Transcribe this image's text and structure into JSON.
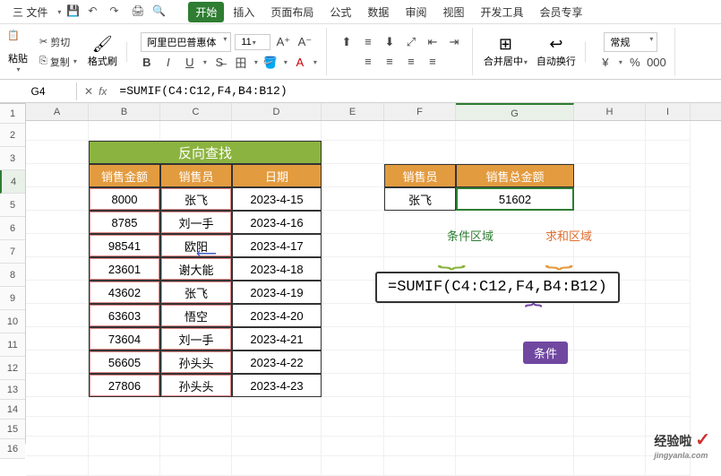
{
  "menu": {
    "file": "三 文件",
    "icons": [
      "save",
      "undo",
      "redo",
      "print",
      "preview"
    ],
    "tabs": [
      "开始",
      "插入",
      "页面布局",
      "公式",
      "数据",
      "审阅",
      "视图",
      "开发工具",
      "会员专享"
    ],
    "active": 0
  },
  "toolbar": {
    "cut": "剪切",
    "copy": "复制",
    "paste": "粘贴",
    "format_painter": "格式刷",
    "font_name": "阿里巴巴普惠体",
    "font_size": "11",
    "merge": "合并居中",
    "wrap": "自动换行",
    "number_fmt": "常规"
  },
  "refbar": {
    "cell": "G4",
    "formula": "=SUMIF(C4:C12,F4,B4:B12)"
  },
  "columns": [
    "A",
    "B",
    "C",
    "D",
    "E",
    "F",
    "G",
    "H",
    "I"
  ],
  "rows": [
    "1",
    "2",
    "3",
    "4",
    "5",
    "6",
    "7",
    "8",
    "9",
    "10",
    "11",
    "12",
    "13",
    "14",
    "15",
    "16"
  ],
  "table": {
    "title": "反向查找",
    "headers": [
      "销售金额",
      "销售员",
      "日期"
    ],
    "data": [
      [
        "8000",
        "张飞",
        "2023-4-15"
      ],
      [
        "8785",
        "刘一手",
        "2023-4-16"
      ],
      [
        "98541",
        "欧阳",
        "2023-4-17"
      ],
      [
        "23601",
        "谢大能",
        "2023-4-18"
      ],
      [
        "43602",
        "张飞",
        "2023-4-19"
      ],
      [
        "63603",
        "悟空",
        "2023-4-20"
      ],
      [
        "73604",
        "刘一手",
        "2023-4-21"
      ],
      [
        "56605",
        "孙头头",
        "2023-4-22"
      ],
      [
        "27806",
        "孙头头",
        "2023-4-23"
      ]
    ]
  },
  "result": {
    "headers": [
      "销售员",
      "销售总金额"
    ],
    "row": [
      "张飞",
      "51602"
    ]
  },
  "annotations": {
    "cond_range": "条件区域",
    "sum_range": "求和区域",
    "condition": "条件",
    "formula_display": "=SUMIF(C4:C12,F4,B4:B12)"
  },
  "watermark": {
    "text": "经验啦",
    "sub": "jingyanla.com",
    "check": "✓"
  }
}
